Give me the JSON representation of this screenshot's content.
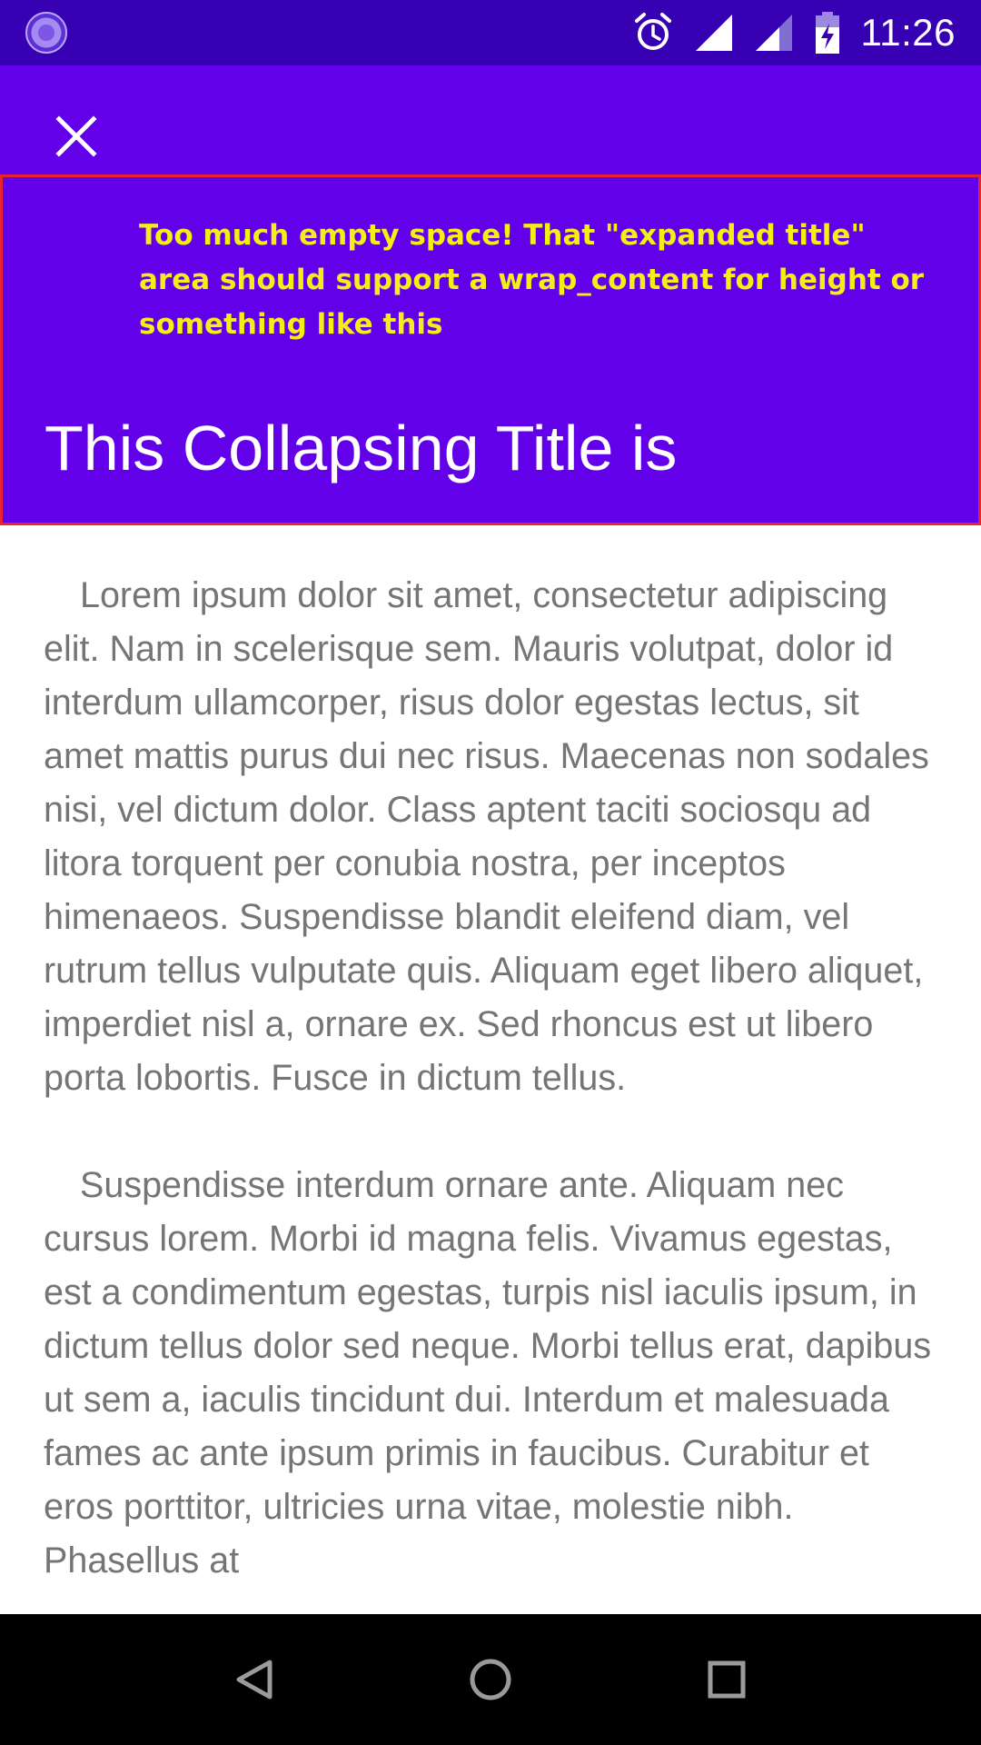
{
  "status_bar": {
    "time": "11:26",
    "icons": [
      "loading-spinner-icon",
      "alarm-icon",
      "cell-signal-icon",
      "cell-signal-partial-icon",
      "battery-charging-icon"
    ]
  },
  "app_bar": {
    "close_icon": "close-icon"
  },
  "expanded_title": {
    "annotation": "Too much empty space! That \"expanded title\" area should support a wrap_content for height or something like this",
    "title": "This Collapsing Title is"
  },
  "content": {
    "paragraphs": [
      "Lorem ipsum dolor sit amet, consectetur adipiscing elit. Nam in scelerisque sem. Mauris volutpat, dolor id interdum ullamcorper, risus dolor egestas lectus, sit amet mattis purus dui nec risus. Maecenas non sodales nisi, vel dictum dolor. Class aptent taciti sociosqu ad litora torquent per conubia nostra, per inceptos himenaeos. Suspendisse blandit eleifend diam, vel rutrum tellus vulputate quis. Aliquam eget libero aliquet, imperdiet nisl a, ornare ex. Sed rhoncus est ut libero porta lobortis. Fusce in dictum tellus.",
      "Suspendisse interdum ornare ante. Aliquam nec cursus lorem. Morbi id magna felis. Vivamus egestas, est a condimentum egestas, turpis nisl iaculis ipsum, in dictum tellus dolor sed neque. Morbi tellus erat, dapibus ut sem a, iaculis tincidunt dui. Interdum et malesuada fames ac ante ipsum primis in faucibus. Curabitur et eros porttitor, ultricies urna vitae, molestie nibh. Phasellus at"
    ]
  },
  "nav_bar": {
    "icons": [
      "back-icon",
      "home-icon",
      "recents-icon"
    ]
  },
  "colors": {
    "status_bar": "#3700b3",
    "app_bar": "#6200ea",
    "annotation_text": "#f4ee17",
    "annotation_border": "#e8232d",
    "body_text": "#757575"
  }
}
